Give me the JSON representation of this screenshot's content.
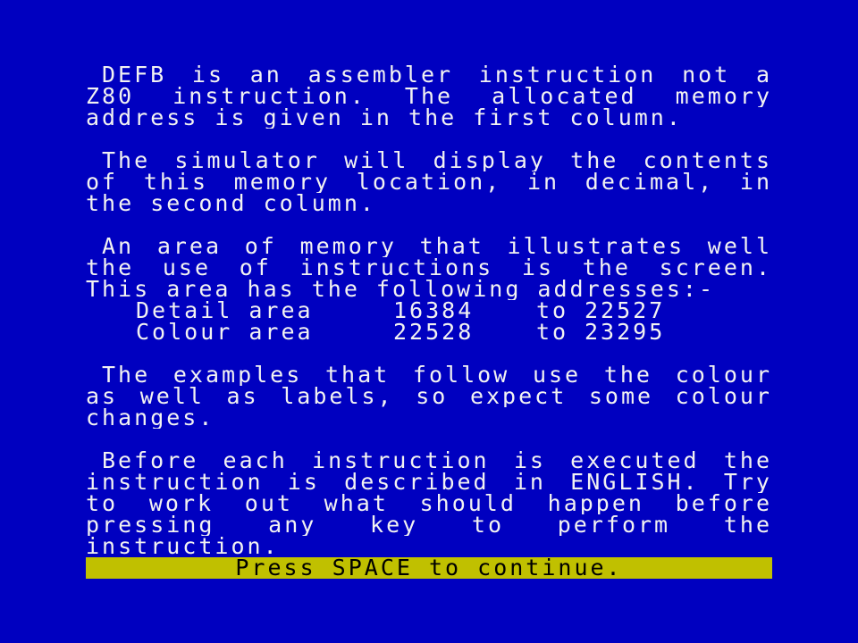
{
  "colors": {
    "background": "#0000c0",
    "text": "#f2f2f2",
    "status_background": "#c0c000",
    "status_text": "#000000"
  },
  "paragraphs": {
    "p1": [
      "DEFB is an assembler instruction not a",
      "Z80 instruction. The allocated memory",
      "address is given in the first column."
    ],
    "p2": [
      "The simulator will display the contents",
      "of this memory location, in decimal, in",
      "the second column."
    ],
    "p3": [
      "An area of memory that illustrates well",
      "the use of instructions is the screen.",
      "This area has the following addresses:-"
    ],
    "address_table": [
      {
        "label": "Detail area",
        "start": "16384",
        "to": "to",
        "end": "22527"
      },
      {
        "label": "Colour area",
        "start": "22528",
        "to": "to",
        "end": "23295"
      }
    ],
    "p4": [
      "The examples that follow use the colour",
      "as well as labels, so expect some colour",
      "changes."
    ],
    "p5": [
      "Before each instruction is executed the",
      "instruction is described in ENGLISH. Try",
      "to work out what should happen before",
      "pressing any key to perform the",
      "instruction."
    ]
  },
  "status_bar": {
    "prompt": "Press SPACE to continue."
  }
}
